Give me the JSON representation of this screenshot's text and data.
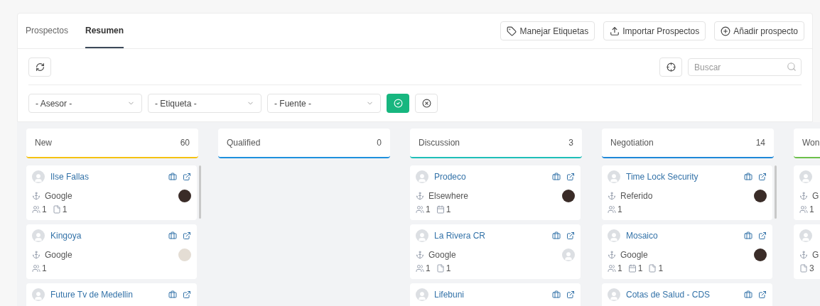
{
  "tabs": [
    {
      "label": "Prospectos",
      "selected": false
    },
    {
      "label": "Resumen",
      "selected": true
    }
  ],
  "actions": [
    {
      "kind": "tag",
      "label": "Manejar Etiquetas"
    },
    {
      "kind": "upload",
      "label": "Importar Prospectos"
    },
    {
      "kind": "add",
      "label": "Añadir prospecto"
    }
  ],
  "search": {
    "placeholder": "Buscar"
  },
  "filters": [
    {
      "value": "- Asesor -"
    },
    {
      "value": "- Etiqueta -"
    },
    {
      "value": "- Fuente -"
    }
  ],
  "columns": [
    {
      "title": "New",
      "count": "60",
      "color": "#f5c211",
      "scroll": true,
      "cards": [
        {
          "title": "Ilse Fallas",
          "source": "Google",
          "owner": {
            "kind": "photo"
          },
          "counts": [
            {
              "kind": "people",
              "value": "1"
            },
            {
              "kind": "file",
              "value": "1"
            }
          ]
        },
        {
          "title": "Kingoya",
          "source": "Google",
          "owner": {
            "kind": "light-photo"
          },
          "counts": [
            {
              "kind": "people",
              "value": "1"
            }
          ]
        },
        {
          "title": "Future Tv de Medellin"
        }
      ]
    },
    {
      "title": "Qualified",
      "count": "0",
      "color": "#1e90dd",
      "scroll": false
    },
    {
      "title": "Discussion",
      "count": "3",
      "color": "#1fbfb8",
      "scroll": false,
      "cards": [
        {
          "title": "Prodeco",
          "source": "Elsewhere",
          "owner": {
            "kind": "photo"
          },
          "counts": [
            {
              "kind": "people",
              "value": "1"
            },
            {
              "kind": "calendar",
              "value": "1"
            }
          ]
        },
        {
          "title": "La Rivera CR",
          "source": "Google",
          "owner": {
            "kind": "placeholder"
          },
          "counts": [
            {
              "kind": "people",
              "value": "1"
            },
            {
              "kind": "file",
              "value": "1"
            }
          ]
        },
        {
          "title": "Lifebuni"
        }
      ]
    },
    {
      "title": "Negotiation",
      "count": "14",
      "color": "#1e88d8",
      "scroll": true,
      "cards": [
        {
          "title": "Time Lock Security",
          "source": "Referido",
          "owner": {
            "kind": "photo"
          },
          "counts": [
            {
              "kind": "people",
              "value": "1"
            }
          ]
        },
        {
          "title": "Mosaico",
          "source": "Google",
          "owner": {
            "kind": "photo"
          },
          "counts": [
            {
              "kind": "people",
              "value": "1"
            },
            {
              "kind": "calendar",
              "value": "1"
            },
            {
              "kind": "file",
              "value": "1"
            }
          ]
        },
        {
          "title": "Cotas de Salud - CDS"
        }
      ]
    },
    {
      "title": "Won",
      "color": "#6cc04a",
      "scroll": false,
      "cards": [
        {
          "source": "G",
          "counts": [
            {
              "kind": "people",
              "value": "1"
            }
          ]
        },
        {
          "source": "G",
          "counts": [
            {
              "kind": "file",
              "value": "3"
            }
          ]
        }
      ]
    }
  ]
}
